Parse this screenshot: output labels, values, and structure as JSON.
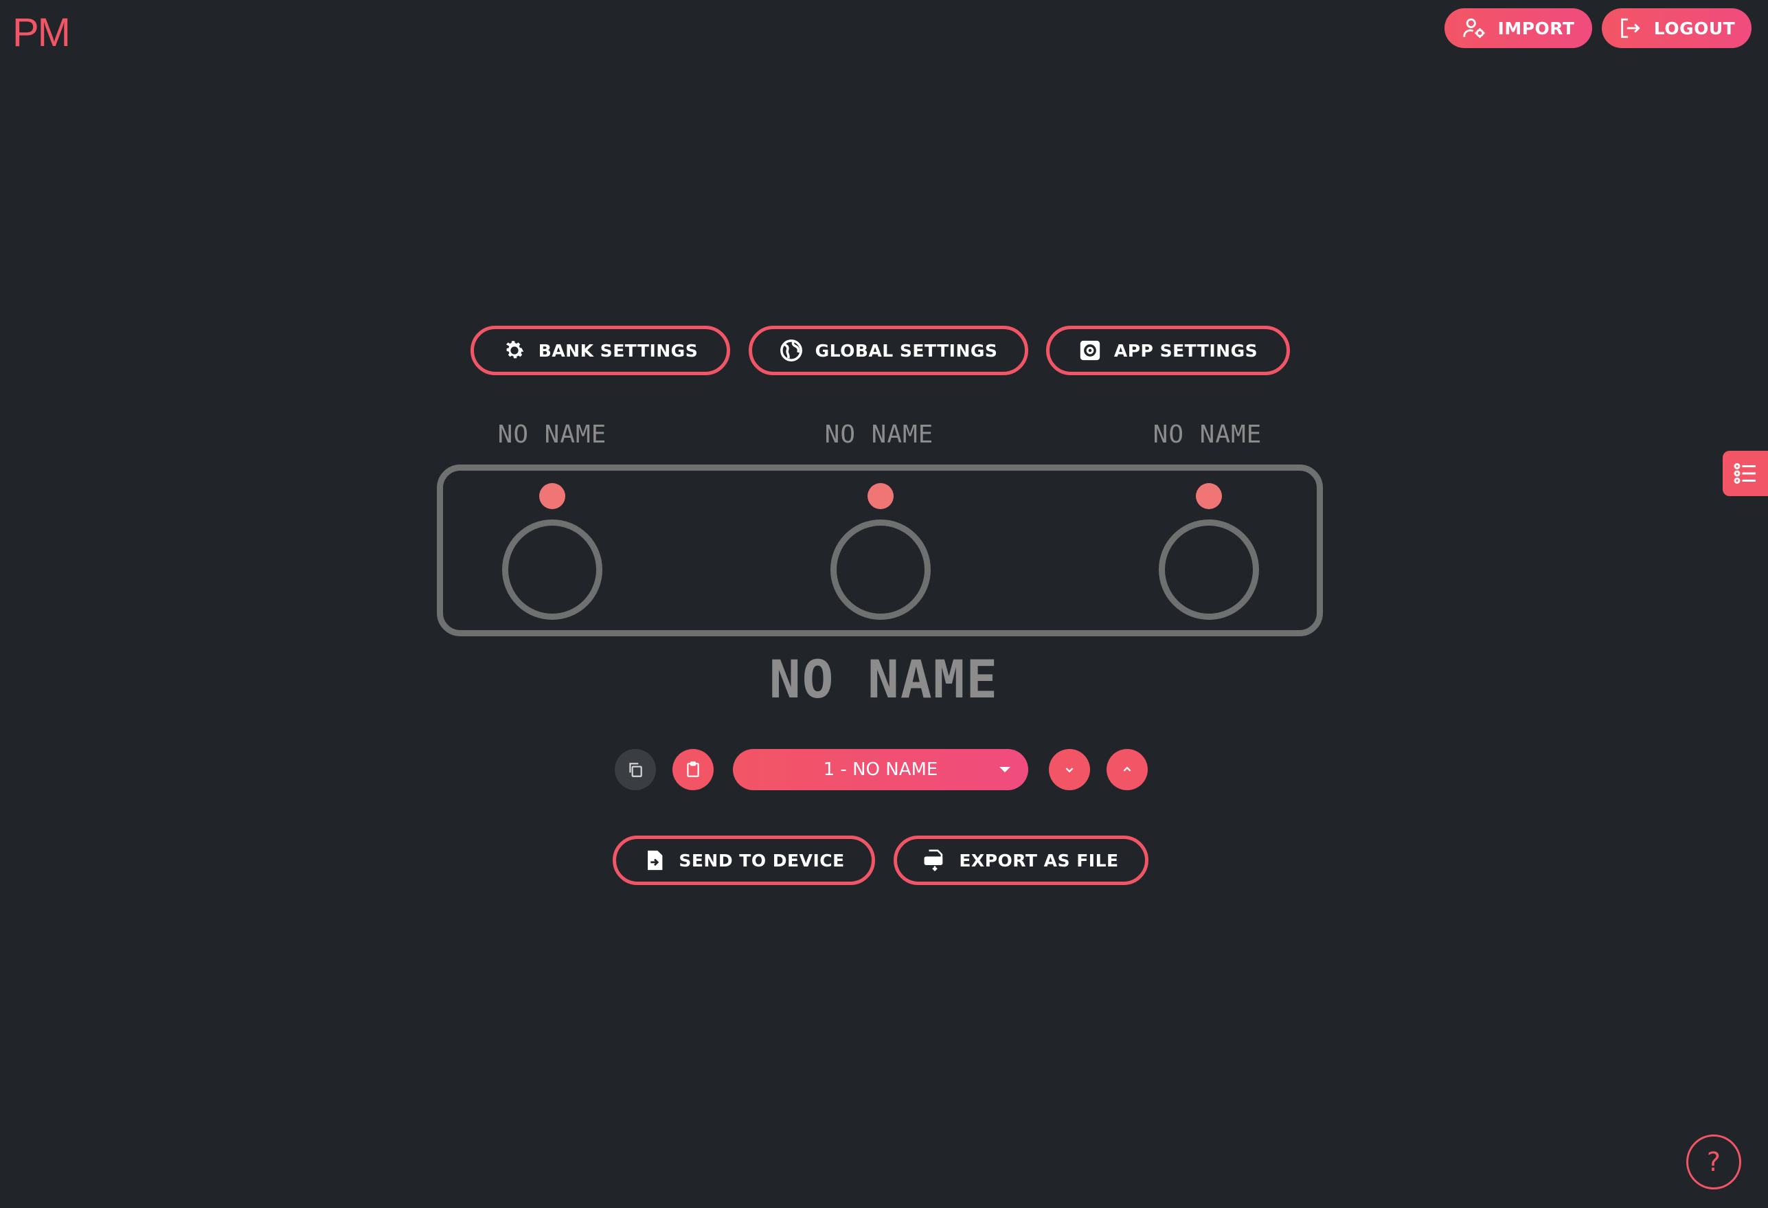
{
  "header": {
    "logo": "PM",
    "import_label": "IMPORT",
    "logout_label": "LOGOUT"
  },
  "settings": {
    "bank_label": "BANK SETTINGS",
    "global_label": "GLOBAL SETTINGS",
    "app_label": "APP SETTINGS"
  },
  "switches": [
    {
      "name": "NO NAME"
    },
    {
      "name": "NO NAME"
    },
    {
      "name": "NO NAME"
    }
  ],
  "bank": {
    "title": "NO NAME",
    "selected": "1 - NO NAME"
  },
  "actions": {
    "send_label": "SEND TO DEVICE",
    "export_label": "EXPORT AS FILE"
  },
  "help_label": "?",
  "colors": {
    "accent": "#f25565",
    "background": "#212529",
    "device_outline": "#6f7070",
    "led": "#f07575"
  },
  "icons": {
    "import": "user-gear-icon",
    "logout": "logout-icon",
    "bank": "gear-icon",
    "global": "globe-icon",
    "app": "app-settings-icon",
    "copy": "copy-icon",
    "paste": "clipboard-icon",
    "down": "chevron-down-icon",
    "up": "chevron-up-icon",
    "send": "file-send-icon",
    "export": "json-file-icon",
    "side": "list-icon"
  }
}
